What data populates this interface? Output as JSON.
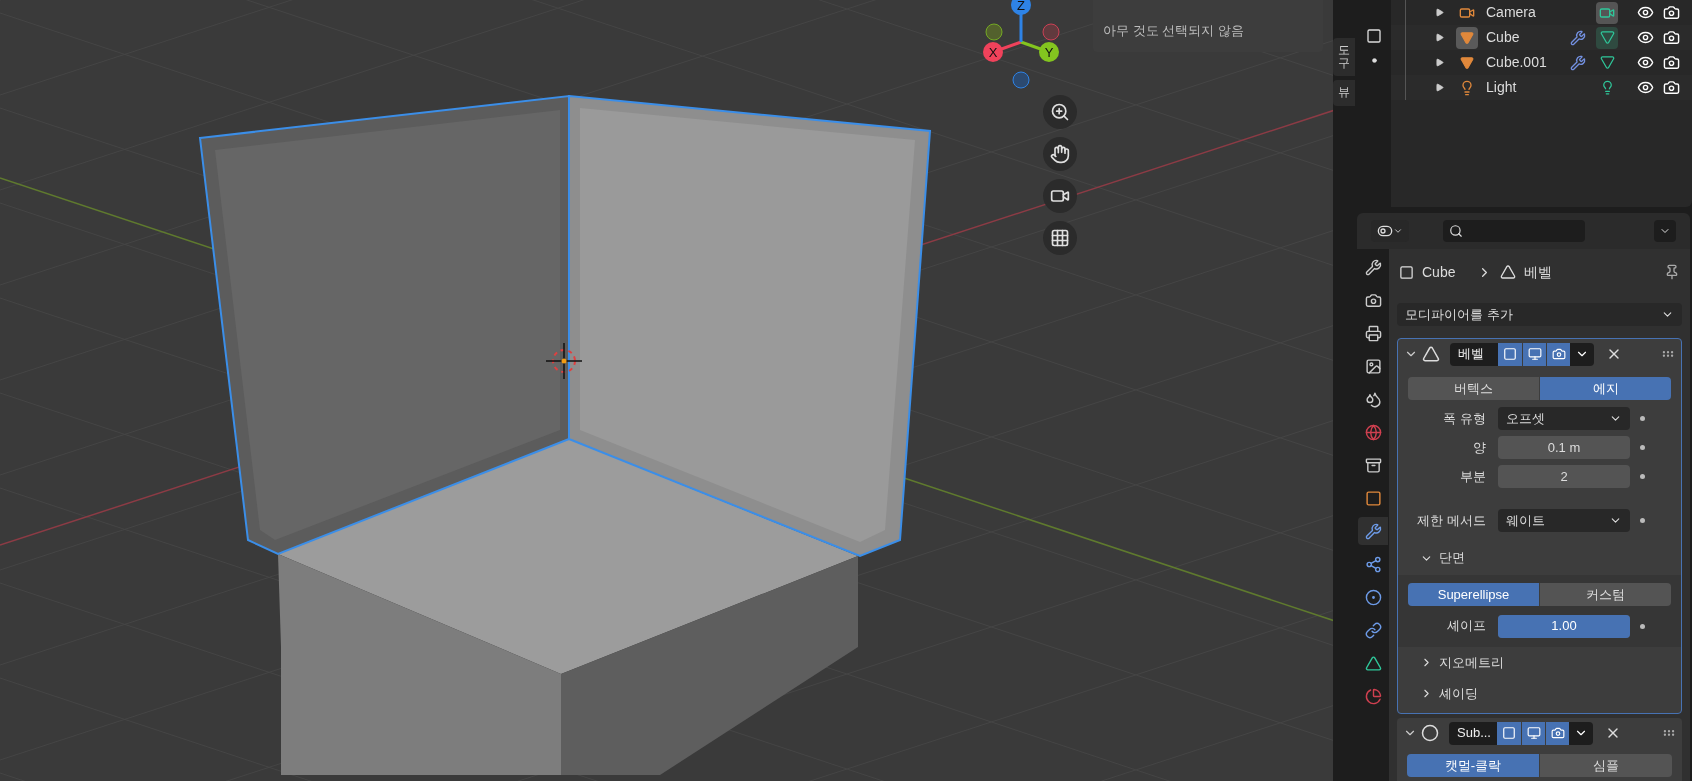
{
  "viewport": {
    "info_popup": {
      "text": "아무 것도 선택되지 않음"
    },
    "gizmo": {
      "axes": [
        {
          "label": "X",
          "color": "#f0425b"
        },
        {
          "label": "Y",
          "color": "#83c51f"
        },
        {
          "label": "Z",
          "color": "#2e83e6"
        }
      ]
    },
    "side_tabs": [
      {
        "label": "도구",
        "selected": false
      },
      {
        "label": "뷰",
        "selected": false
      }
    ]
  },
  "outliner": {
    "items": [
      {
        "name": "Camera",
        "kind": "camera",
        "active": false,
        "modifier": false,
        "data": {
          "kind": "camera",
          "active": true
        }
      },
      {
        "name": "Cube",
        "kind": "mesh",
        "active": true,
        "modifier": true,
        "data": {
          "kind": "mesh",
          "active": true
        }
      },
      {
        "name": "Cube.001",
        "kind": "mesh",
        "active": false,
        "modifier": true,
        "data": {
          "kind": "mesh",
          "active": false
        }
      },
      {
        "name": "Light",
        "kind": "light",
        "active": false,
        "modifier": false,
        "data": {
          "kind": "light",
          "active": false
        }
      }
    ]
  },
  "properties": {
    "tabs": [
      {
        "kind": "tool",
        "selected": false
      },
      {
        "kind": "render",
        "selected": false
      },
      {
        "kind": "output",
        "selected": false
      },
      {
        "kind": "view_layer",
        "selected": false
      },
      {
        "kind": "scene",
        "selected": false
      },
      {
        "kind": "world",
        "selected": false
      },
      {
        "kind": "collection",
        "selected": false
      },
      {
        "kind": "object",
        "selected": false
      },
      {
        "kind": "modifier",
        "selected": true
      },
      {
        "kind": "particles",
        "selected": false
      },
      {
        "kind": "physics",
        "selected": false
      },
      {
        "kind": "constraints",
        "selected": false
      },
      {
        "kind": "data",
        "selected": false
      },
      {
        "kind": "material",
        "selected": false
      }
    ],
    "breadcrumb": [
      "Cube",
      "베벨"
    ],
    "add_modifier": "모디파이어를 추가",
    "modifiers": [
      {
        "kind": "bevel",
        "name": "베벨",
        "expanded": true,
        "affect": [
          {
            "label": "버텍스",
            "selected": false
          },
          {
            "label": "에지",
            "selected": true
          }
        ],
        "fields": [
          {
            "label": "폭 유형",
            "kind": "dropdown",
            "value": "오프셋"
          },
          {
            "label": "양",
            "kind": "number",
            "value": "0.1 m"
          },
          {
            "label": "부분",
            "kind": "number",
            "value": "2"
          },
          {
            "label": "제한 메서드",
            "kind": "dropdown",
            "value": "웨이트"
          }
        ],
        "profile": {
          "label": "단면",
          "expanded": true,
          "types": [
            {
              "label": "Superellipse",
              "selected": true
            },
            {
              "label": "커스텀",
              "selected": false
            }
          ],
          "shape": {
            "label": "셰이프",
            "value": "1.00",
            "level": 1
          }
        },
        "subpanels": [
          {
            "label": "지오메트리",
            "expanded": false
          },
          {
            "label": "셰이딩",
            "expanded": false
          }
        ]
      },
      {
        "kind": "subsurf",
        "name": "Sub...",
        "expanded": true,
        "types": [
          {
            "label": "캣멀-클락",
            "selected": true
          },
          {
            "label": "심플",
            "selected": false
          }
        ]
      }
    ]
  }
}
